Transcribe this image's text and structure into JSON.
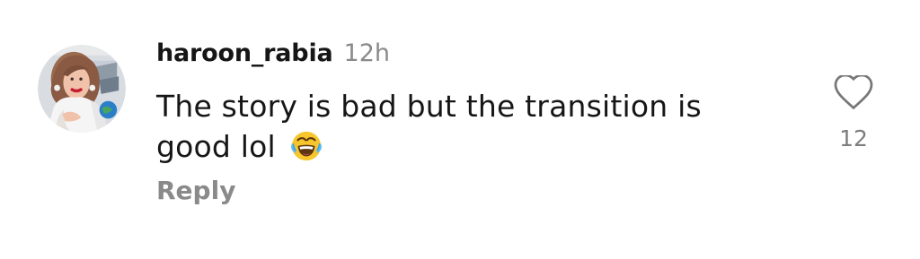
{
  "comment": {
    "username": "haroon_rabia",
    "timestamp": "12h",
    "text": "The story is bad but the transition is good lol",
    "emoji": "face-with-tears-of-joy-emoji",
    "reply_label": "Reply",
    "like_count": "12"
  },
  "icons": {
    "like": "heart-outline-icon",
    "avatar": "profile-photo"
  },
  "colors": {
    "primary_text": "#161616",
    "secondary_text": "#8a8a8a",
    "background": "#ffffff"
  }
}
